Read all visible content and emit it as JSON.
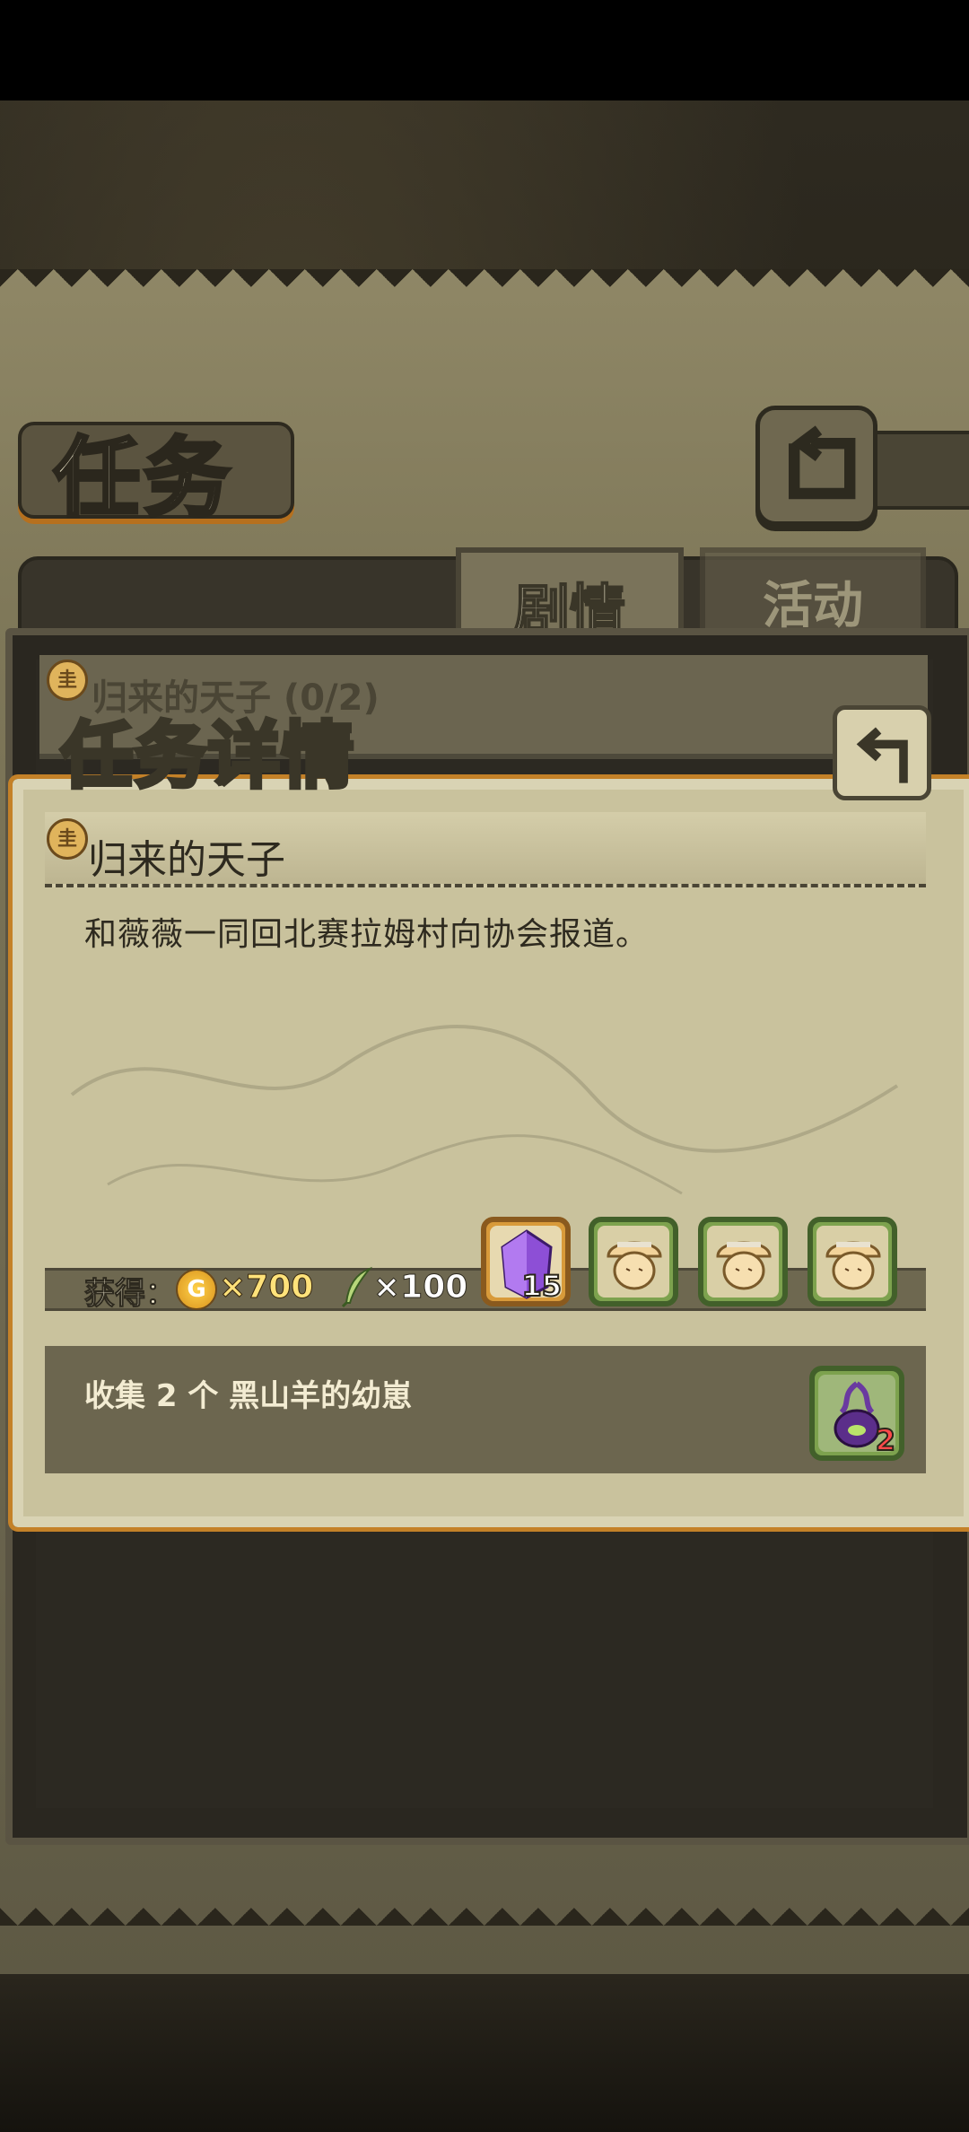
{
  "header": {
    "title": "任务"
  },
  "tabs": [
    {
      "label": "剧情",
      "active": true
    },
    {
      "label": "活动",
      "active": false
    }
  ],
  "quest_list": [
    {
      "title": "归来的天子 (0/2)"
    }
  ],
  "detail": {
    "panel_title": "任务详情",
    "quest_name": "归来的天子",
    "description": "和薇薇一同回北赛拉姆村向协会报道。",
    "reward_label": "获得：",
    "coin_symbol": "G",
    "coin_amount": "×700",
    "feather_amount": "×100",
    "reward_items": [
      {
        "icon": "purple-crystal-icon",
        "count": "15"
      },
      {
        "icon": "mushroom-creature-icon",
        "count": ""
      },
      {
        "icon": "mushroom-creature-icon",
        "count": ""
      },
      {
        "icon": "mushroom-creature-icon",
        "count": ""
      }
    ],
    "goal_text": "收集 2 个 黑山羊的幼崽",
    "goal_item": {
      "icon": "black-goat-spawn-icon",
      "count": "2"
    }
  },
  "seal_glyph": "圭",
  "colors": {
    "accent_orange": "#c48128",
    "parchment": "#c9c29d",
    "dark_frame": "#2a2720"
  }
}
